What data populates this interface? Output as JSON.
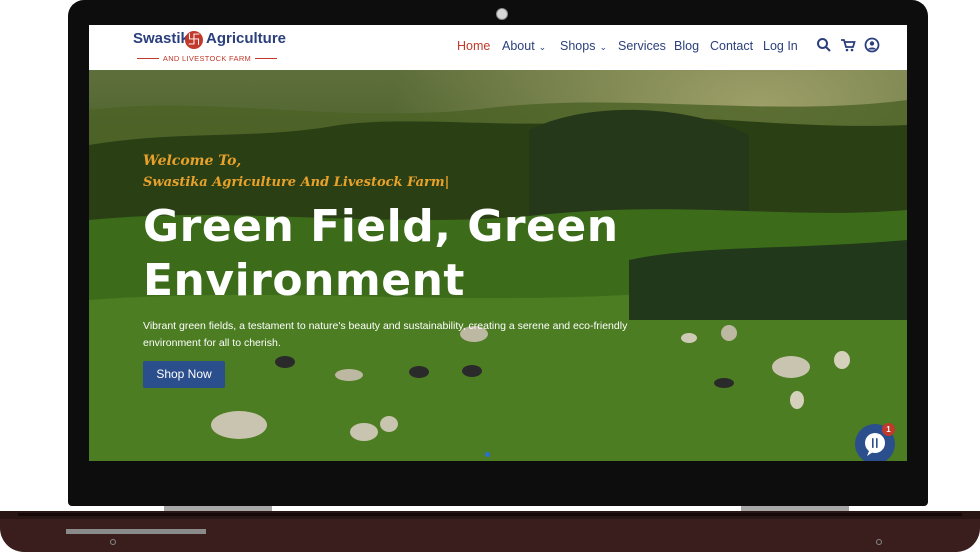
{
  "logo": {
    "word1": "Swastik",
    "emblem": "卐",
    "word2": "Agriculture",
    "subtitle": "AND LIVESTOCK FARM"
  },
  "nav": {
    "items": [
      {
        "label": "Home",
        "active": true
      },
      {
        "label": "About",
        "dropdown": true
      },
      {
        "label": "Shops",
        "dropdown": true
      },
      {
        "label": "Services"
      },
      {
        "label": "Blog"
      },
      {
        "label": "Contact"
      },
      {
        "label": "Log In"
      }
    ],
    "icons": [
      "search-icon",
      "cart-icon",
      "user-account-icon"
    ],
    "caret": "⌄"
  },
  "hero": {
    "welcome": "Welcome To,",
    "farm_name": "Swastika Agriculture And Livestock Farm|",
    "headline_line1": "Green Field, Green",
    "headline_line2": "Environment",
    "description": "Vibrant green fields, a testament to nature's beauty and sustainability, creating a serene and eco-friendly environment for all to cherish.",
    "button_label": "Shop Now"
  },
  "chat": {
    "badge_count": "1"
  },
  "colors": {
    "brand_blue": "#2b3f7c",
    "accent_red": "#c0392b",
    "welcome_orange": "#e8a22b",
    "button_blue": "#2b4e8c"
  }
}
